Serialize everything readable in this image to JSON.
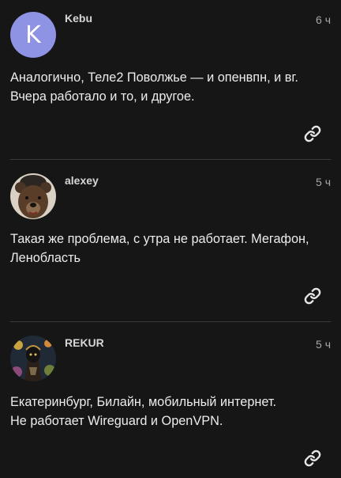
{
  "posts": [
    {
      "username": "Kebu",
      "avatar_letter": "K",
      "time": "6 ч",
      "line1": "Аналогично, Теле2 Поволжье — и опенвпн, и вг.",
      "line2": "Вчера работало и то, и другое."
    },
    {
      "username": "alexey",
      "time": "5 ч",
      "line1": "Такая же проблема, с утра не работает. Мегафон,",
      "line2": "Ленобласть"
    },
    {
      "username": "REKUR",
      "time": "5 ч",
      "line1": "Екатеринбург, Билайн, мобильный интернет.",
      "line2": "Не работает Wireguard и OpenVPN."
    }
  ],
  "icons": {
    "share_link": "link-icon"
  },
  "colors": {
    "background": "#161616",
    "avatar_k": "#8f93e3",
    "text": "#ececec",
    "muted": "#a8a8a8",
    "separator": "#3a3a3a"
  }
}
